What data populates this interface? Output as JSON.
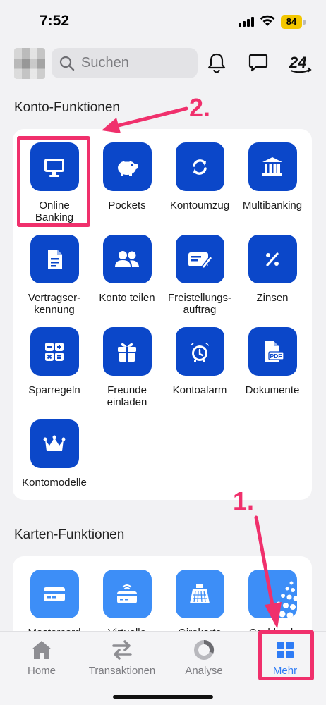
{
  "status": {
    "time": "7:52",
    "battery": "84"
  },
  "header": {
    "search_placeholder": "Suchen",
    "icons": [
      "bell-icon",
      "chat-icon",
      "24-support-icon"
    ]
  },
  "sections": {
    "konto": {
      "title": "Konto-Funktionen",
      "items": [
        {
          "label": "Online\nBanking",
          "icon": "monitor-icon"
        },
        {
          "label": "Pockets",
          "icon": "piggy-bank-icon"
        },
        {
          "label": "Kontoumzug",
          "icon": "sync-icon"
        },
        {
          "label": "Multibanking",
          "icon": "bank-icon"
        },
        {
          "label": "Vertragser-\nkennung",
          "icon": "document-icon"
        },
        {
          "label": "Konto teilen",
          "icon": "users-icon"
        },
        {
          "label": "Freistellungs-\nauftrag",
          "icon": "signature-icon"
        },
        {
          "label": "Zinsen",
          "icon": "percent-icon"
        },
        {
          "label": "Sparregeln",
          "icon": "calculator-icon"
        },
        {
          "label": "Freunde\neinladen",
          "icon": "gift-icon"
        },
        {
          "label": "Kontoalarm",
          "icon": "alarm-clock-icon"
        },
        {
          "label": "Dokumente",
          "icon": "pdf-icon"
        },
        {
          "label": "Kontomodelle",
          "icon": "crown-icon"
        }
      ]
    },
    "karten": {
      "title": "Karten-Funktionen",
      "items": [
        {
          "label": "Mastercard",
          "icon": "card-icon"
        },
        {
          "label": "Virtuelle",
          "icon": "virtual-card-icon"
        },
        {
          "label": "Girokarte",
          "icon": "girocard-icon"
        },
        {
          "label": "Cashback",
          "icon": "dots-icon"
        }
      ]
    }
  },
  "annotations": {
    "step1": "1.",
    "step2": "2."
  },
  "tabbar": [
    {
      "label": "Home",
      "icon": "home-icon"
    },
    {
      "label": "Transaktionen",
      "icon": "transfer-icon"
    },
    {
      "label": "Analyse",
      "icon": "donut-chart-icon"
    },
    {
      "label": "Mehr",
      "icon": "grid-icon",
      "active": true
    }
  ],
  "colors": {
    "primary": "#0b47c9",
    "light_blue": "#3d8ef7",
    "highlight": "#f0306c",
    "active_tab": "#2f7cf5"
  }
}
